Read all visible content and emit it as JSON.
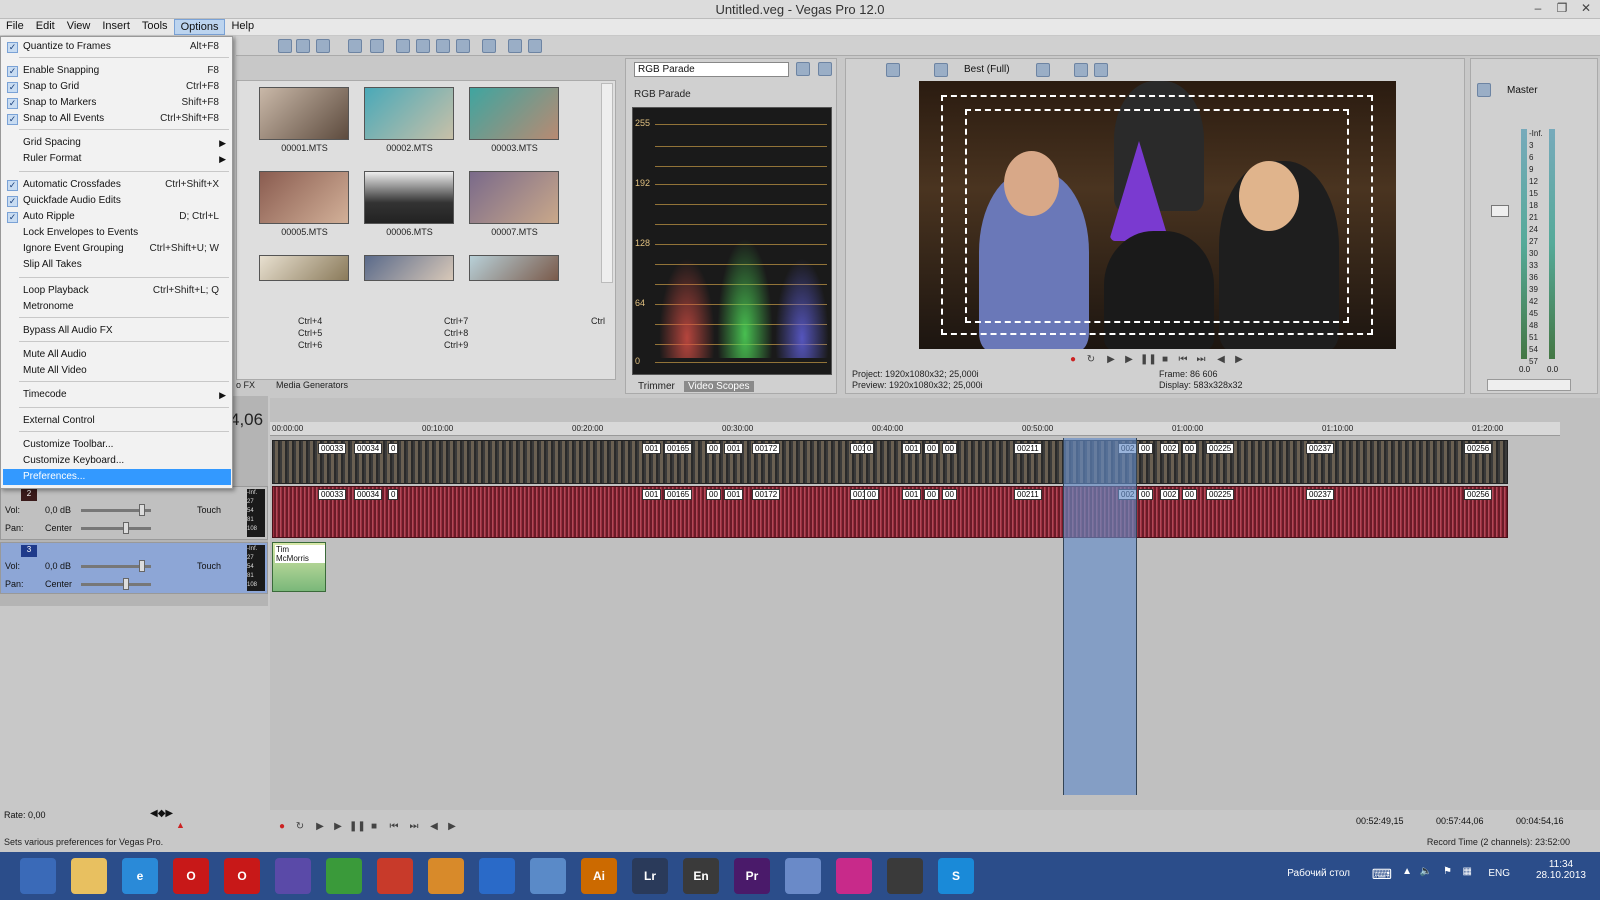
{
  "window": {
    "title": "Untitled.veg - Vegas Pro 12.0"
  },
  "menubar": {
    "items": [
      "File",
      "Edit",
      "View",
      "Insert",
      "Tools",
      "Options",
      "Help"
    ],
    "active": "Options"
  },
  "options_menu": {
    "items": [
      {
        "label": "Quantize to Frames",
        "shortcut": "Alt+F8",
        "checked": true
      },
      {
        "label": "Enable Snapping",
        "shortcut": "F8",
        "checked": true
      },
      {
        "label": "Snap to Grid",
        "shortcut": "Ctrl+F8",
        "checked": true
      },
      {
        "label": "Snap to Markers",
        "shortcut": "Shift+F8",
        "checked": true
      },
      {
        "label": "Snap to All Events",
        "shortcut": "Ctrl+Shift+F8",
        "checked": true
      },
      {
        "label": "Grid Spacing",
        "shortcut": "",
        "submenu": true
      },
      {
        "label": "Ruler Format",
        "shortcut": "",
        "submenu": true
      },
      {
        "label": "Automatic Crossfades",
        "shortcut": "Ctrl+Shift+X",
        "checked": true
      },
      {
        "label": "Quickfade Audio Edits",
        "shortcut": "",
        "checked": true
      },
      {
        "label": "Auto Ripple",
        "shortcut": "D; Ctrl+L",
        "checked": true
      },
      {
        "label": "Lock Envelopes to Events",
        "shortcut": ""
      },
      {
        "label": "Ignore Event Grouping",
        "shortcut": "Ctrl+Shift+U; W"
      },
      {
        "label": "Slip All Takes",
        "shortcut": ""
      },
      {
        "label": "Loop Playback",
        "shortcut": "Ctrl+Shift+L; Q"
      },
      {
        "label": "Metronome",
        "shortcut": ""
      },
      {
        "label": "Bypass All Audio FX",
        "shortcut": ""
      },
      {
        "label": "Mute All Audio",
        "shortcut": ""
      },
      {
        "label": "Mute All Video",
        "shortcut": ""
      },
      {
        "label": "Timecode",
        "shortcut": "",
        "submenu": true
      },
      {
        "label": "External Control",
        "shortcut": ""
      },
      {
        "label": "Customize Toolbar...",
        "shortcut": ""
      },
      {
        "label": "Customize Keyboard...",
        "shortcut": ""
      },
      {
        "label": "Preferences...",
        "shortcut": "",
        "highlighted": true
      }
    ]
  },
  "explorer": {
    "files": [
      "00001.MTS",
      "00002.MTS",
      "00003.MTS",
      "00005.MTS",
      "00006.MTS",
      "00007.MTS"
    ],
    "shortcuts": [
      "Ctrl+4",
      "Ctrl+7",
      "Ctrl",
      "Ctrl+5",
      "Ctrl+8",
      "Ctrl+6",
      "Ctrl+9"
    ],
    "tabs": [
      "o FX",
      "Media Generators"
    ]
  },
  "scopes": {
    "select_value": "RGB Parade",
    "title": "RGB Parade",
    "levels": [
      "255",
      "192",
      "128",
      "64",
      "0"
    ],
    "tabs": [
      "Trimmer",
      "Video Scopes"
    ],
    "active_tab": "Video Scopes"
  },
  "preview": {
    "quality": "Best (Full)",
    "project": "Project:  1920x1080x32; 25,000i",
    "preview_info": "Preview:  1920x1080x32; 25,000i",
    "frame": "Frame:     86 606",
    "display": "Display:   583x328x32"
  },
  "mixer": {
    "label": "Master",
    "scale": [
      "-Inf.",
      "3",
      "6",
      "9",
      "12",
      "15",
      "18",
      "21",
      "24",
      "27",
      "30",
      "33",
      "36",
      "39",
      "42",
      "45",
      "48",
      "51",
      "54",
      "57"
    ],
    "bottom": [
      "0.0",
      "0.0"
    ]
  },
  "timeline": {
    "position": "4,06",
    "ruler": [
      "00:00:00",
      "00:10:00",
      "00:20:00",
      "00:30:00",
      "00:40:00",
      "00:50:00",
      "01:00:00",
      "01:10:00",
      "01:20:00"
    ],
    "video_labels": [
      "00033",
      "00034",
      "0",
      "001",
      "00165",
      "00",
      "001",
      "00172",
      "001",
      "0",
      "001",
      "00",
      "00",
      "00211",
      "002",
      "00",
      "002",
      "00",
      "00225",
      "00237",
      "00256"
    ],
    "audio_labels": [
      "00033",
      "00034",
      "0",
      "001",
      "00165",
      "00",
      "001",
      "00172",
      "001",
      "00",
      "001",
      "00",
      "00",
      "00211",
      "002",
      "00",
      "002",
      "00",
      "00225",
      "00237",
      "00256"
    ],
    "music_clip": "Tim McMorris"
  },
  "tracks": [
    {
      "num": "2",
      "vol_label": "Vol:",
      "vol": "0,0 dB",
      "pan_label": "Pan:",
      "pan": "Center",
      "mode": "Touch"
    },
    {
      "num": "3",
      "vol_label": "Vol:",
      "vol": "0,0 dB",
      "pan_label": "Pan:",
      "pan": "Center",
      "mode": "Touch"
    }
  ],
  "track_meter_scale": [
    "-Inf.",
    "27",
    "54",
    "81",
    "108"
  ],
  "rate": "Rate: 0,00",
  "timecodes": {
    "start": "00:52:49,15",
    "end": "00:57:44,06",
    "length": "00:04:54,16"
  },
  "status": {
    "text": "Sets various preferences for Vegas Pro.",
    "record": "Record Time (2 channels): 23:52:00"
  },
  "taskbar": {
    "apps": [
      "",
      "",
      "e",
      "O",
      "O",
      "",
      "",
      "",
      "",
      "",
      "",
      "Ai",
      "Lr",
      "En",
      "Pr",
      "",
      "",
      "",
      "S"
    ],
    "desktop": "Рабочий стол",
    "lang": "ENG",
    "time": "11:34",
    "date": "28.10.2013"
  }
}
